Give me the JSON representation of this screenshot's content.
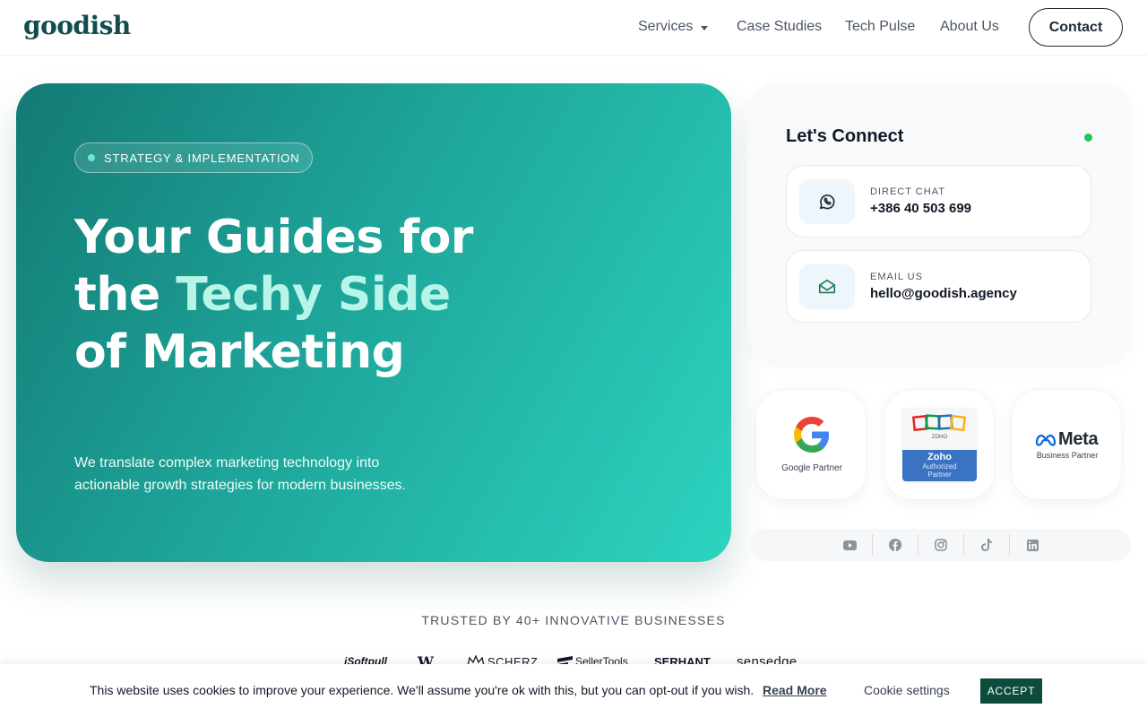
{
  "header": {
    "logo": "goodish",
    "nav": [
      {
        "label": "Services"
      },
      {
        "label": "Case Studies"
      },
      {
        "label": "Tech Pulse"
      },
      {
        "label": "About Us"
      }
    ],
    "contact_label": "Contact"
  },
  "hero": {
    "pill": "STRATEGY & IMPLEMENTATION",
    "title_line1": "Your Guides for",
    "title_line2_a": "the ",
    "title_line2_accent": "Techy Side",
    "title_line3": "of Marketing",
    "description_line1": "We translate complex marketing technology into",
    "description_line2": "actionable growth strategies for modern businesses."
  },
  "connect": {
    "title": "Let's Connect",
    "items": [
      {
        "label": "DIRECT CHAT",
        "value": "+386 40 503 699",
        "icon": "whatsapp-icon"
      },
      {
        "label": "EMAIL US",
        "value": "hello@goodish.agency",
        "icon": "mail-icon"
      }
    ]
  },
  "partners": {
    "google": "Google Partner",
    "zoho_brand": "ZOHO",
    "zoho_name": "Zoho",
    "zoho_sub1": "Authorized",
    "zoho_sub2": "Partner",
    "meta_name": "Meta",
    "meta_sub": "Business Partner"
  },
  "social": [
    "youtube-icon",
    "facebook-icon",
    "instagram-icon",
    "tiktok-icon",
    "linkedin-icon"
  ],
  "trusted": {
    "heading": "TRUSTED BY 40+ INNOVATIVE BUSINESSES",
    "brands": [
      "iSoftpull",
      "W",
      "SCHERZ",
      "SellerTools",
      "SERHANT.",
      "sensedge"
    ]
  },
  "cookie": {
    "text": "This website uses cookies to improve your experience. We'll assume you're ok with this, but you can opt-out if you wish.",
    "read_more": "Read More",
    "settings": "Cookie settings",
    "accept": "ACCEPT"
  },
  "colors": {
    "brand": "#124c4c",
    "hero_start": "#137a74",
    "hero_end": "#2dd4bf",
    "accent_text": "#b7f5e8",
    "online": "#22c55e",
    "accept_bg": "#0d4c3c"
  }
}
